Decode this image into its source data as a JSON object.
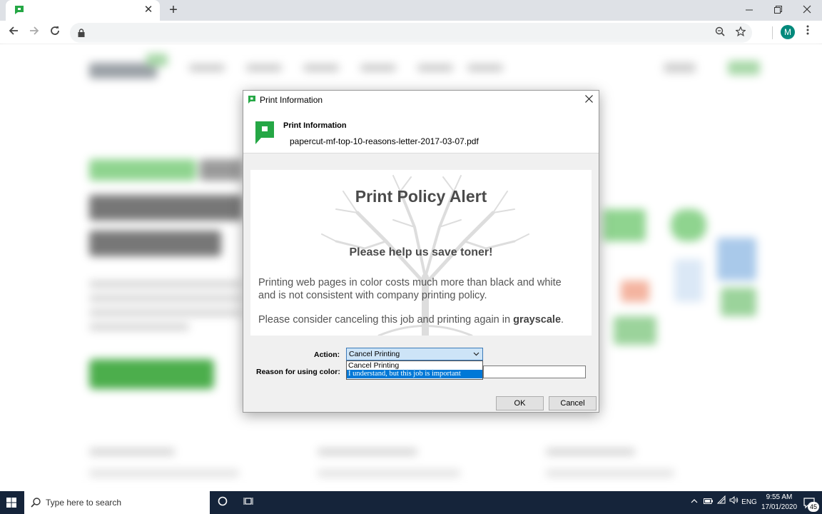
{
  "browser": {
    "new_tab_symbol": "+",
    "close_tab_symbol": "✕",
    "profile_initial": "M",
    "brand_color": "#25a745"
  },
  "dialog": {
    "window_title": "Print Information",
    "header_title": "Print Information",
    "file_name": "papercut-mf-top-10-reasons-letter-2017-03-07.pdf",
    "alert": {
      "title": "Print Policy Alert",
      "subtitle": "Please help us save toner!",
      "body_line1": "Printing web pages in color costs much more than black and white",
      "body_line2": "and is not consistent with company printing policy.",
      "body_prefix": "Please consider canceling this job and printing again in ",
      "body_emphasis": "grayscale",
      "body_suffix": "."
    },
    "action_label": "Action:",
    "action_selected": "Cancel Printing",
    "action_options": [
      "Cancel Printing",
      "I understand, but this job is important"
    ],
    "reason_label": "Reason for using color:",
    "reason_value": "",
    "ok_label": "OK",
    "cancel_label": "Cancel"
  },
  "taskbar": {
    "search_placeholder": "Type here to search",
    "language": "ENG",
    "time": "9:55 AM",
    "date": "17/01/2020",
    "notification_count": "45"
  },
  "colors": {
    "accent": "#0078d7",
    "taskbar": "#15243a",
    "papercut_green": "#25a745"
  }
}
